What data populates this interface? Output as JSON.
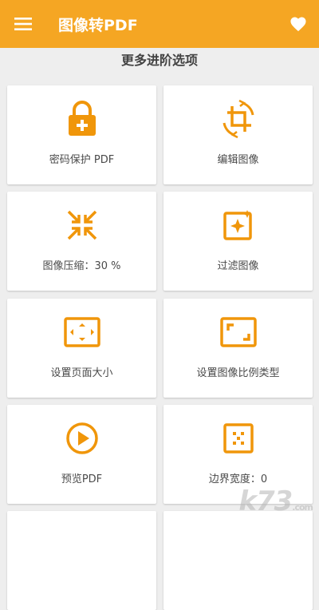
{
  "appbar": {
    "title": "图像转PDF",
    "menu_icon": "hamburger-menu-icon",
    "favorite_icon": "heart-icon",
    "color": "#f5a623"
  },
  "section": {
    "title": "更多进阶选项"
  },
  "options": [
    {
      "label": "密码保护 PDF",
      "icon": "lock-plus-icon"
    },
    {
      "label": "编辑图像",
      "icon": "crop-rotate-icon"
    },
    {
      "label": "图像压缩：30 %",
      "icon": "compress-icon"
    },
    {
      "label": "过滤图像",
      "icon": "filter-sparkle-icon"
    },
    {
      "label": "设置页面大小",
      "icon": "page-size-icon"
    },
    {
      "label": "设置图像比例类型",
      "icon": "aspect-ratio-icon"
    },
    {
      "label": "预览PDF",
      "icon": "play-circle-icon"
    },
    {
      "label": "边界宽度：0",
      "icon": "border-width-icon"
    }
  ],
  "accent_color": "#f0960a",
  "watermark": {
    "text": "k73",
    "suffix": ".com"
  }
}
